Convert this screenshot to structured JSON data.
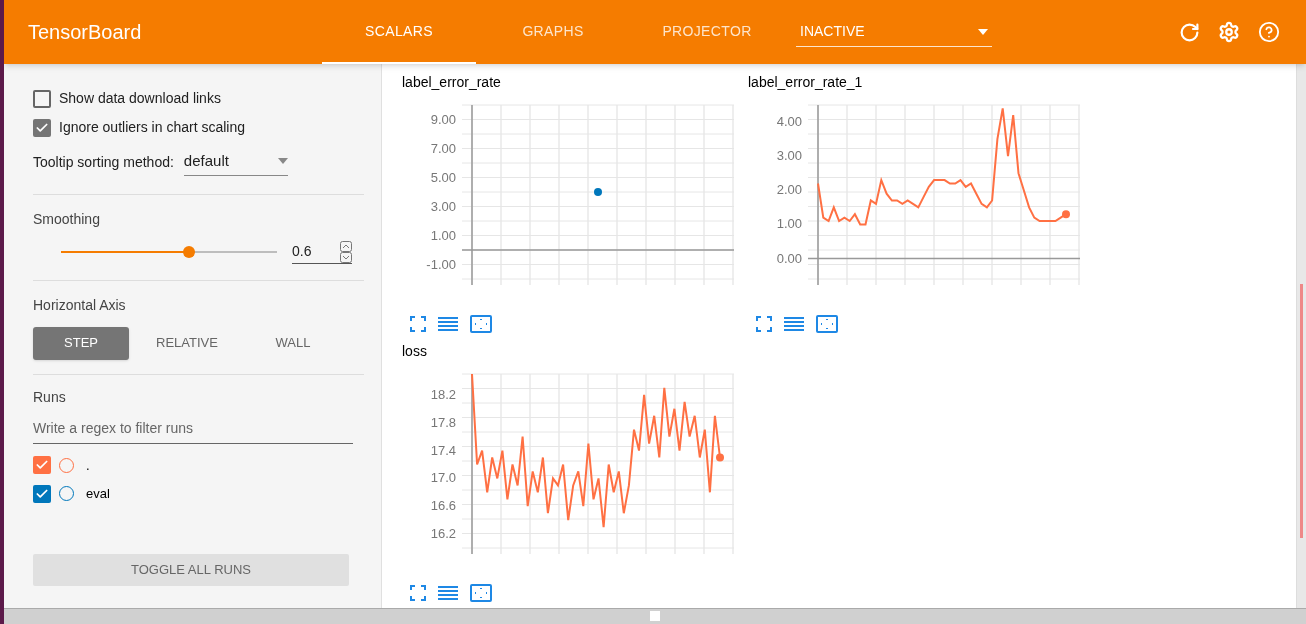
{
  "header": {
    "title": "TensorBoard",
    "tabs": [
      {
        "label": "SCALARS",
        "selected": true
      },
      {
        "label": "GRAPHS",
        "selected": false
      },
      {
        "label": "PROJECTOR",
        "selected": false
      }
    ],
    "dropdown": {
      "value": "INACTIVE"
    }
  },
  "sidebar": {
    "options": [
      {
        "label": "Show data download links",
        "checked": false
      },
      {
        "label": "Ignore outliers in chart scaling",
        "checked": true
      }
    ],
    "tooltip_sorting": {
      "label": "Tooltip sorting method:",
      "value": "default"
    },
    "smoothing": {
      "label": "Smoothing",
      "level": 0.6,
      "reading": "0.6"
    },
    "horizontal_axis": {
      "label": "Horizontal Axis",
      "options": [
        {
          "label": "STEP",
          "selected": true
        },
        {
          "label": "RELATIVE",
          "selected": false
        },
        {
          "label": "WALL",
          "selected": false
        }
      ]
    },
    "runs": {
      "label": "Runs",
      "placeholder": "Write a regex to filter runs",
      "items": [
        {
          "label": ".",
          "checked": true,
          "color": "#ff7043"
        },
        {
          "label": "eval",
          "checked": true,
          "color": "#0077bb"
        }
      ],
      "toggle_button": "TOGGLE ALL RUNS"
    }
  },
  "charts": [
    {
      "title": "label_error_rate",
      "chart_data": {
        "type": "line",
        "grid": true,
        "ylim": [
          -2,
          10
        ],
        "yticks": [
          {
            "value": 9,
            "label": "9.00"
          },
          {
            "value": 7,
            "label": "7.00"
          },
          {
            "value": 5,
            "label": "5.00"
          },
          {
            "value": 3,
            "label": "3.00"
          },
          {
            "value": 1,
            "label": "1.00"
          },
          {
            "value": -1,
            "label": "-1.00"
          }
        ],
        "series": [
          {
            "color": "#0077bb",
            "marker": true,
            "values": [
              4.0
            ]
          }
        ]
      }
    },
    {
      "title": "label_error_rate_1",
      "chart_data": {
        "type": "line",
        "grid": true,
        "ylim": [
          -0.6,
          4.5
        ],
        "yticks": [
          {
            "value": 4,
            "label": "4.00"
          },
          {
            "value": 3,
            "label": "3.00"
          },
          {
            "value": 2,
            "label": "2.00"
          },
          {
            "value": 1,
            "label": "1.00"
          },
          {
            "value": 0,
            "label": "0.00"
          }
        ],
        "series": [
          {
            "color": "#ff7043",
            "marker": true,
            "values": [
              2.2,
              1.2,
              1.1,
              1.5,
              1.1,
              1.2,
              1.1,
              1.3,
              1.0,
              1.0,
              1.7,
              1.6,
              2.3,
              1.9,
              1.7,
              1.7,
              1.6,
              1.7,
              1.6,
              1.5,
              1.8,
              2.1,
              2.3,
              2.3,
              2.3,
              2.2,
              2.2,
              2.3,
              2.1,
              2.2,
              1.9,
              1.6,
              1.5,
              1.7,
              3.5,
              4.4,
              3.0,
              4.2,
              2.5,
              2.0,
              1.5,
              1.2,
              1.1,
              1.1,
              1.1,
              1.1,
              1.2,
              1.3
            ]
          }
        ]
      }
    },
    {
      "title": "loss",
      "chart_data": {
        "type": "line",
        "grid": true,
        "ylim": [
          16.0,
          18.5
        ],
        "yticks": [
          {
            "value": 18.2,
            "label": "18.2"
          },
          {
            "value": 17.8,
            "label": "17.8"
          },
          {
            "value": 17.4,
            "label": "17.4"
          },
          {
            "value": 17.0,
            "label": "17.0"
          },
          {
            "value": 16.6,
            "label": "16.6"
          },
          {
            "value": 16.2,
            "label": "16.2"
          }
        ],
        "series": [
          {
            "color": "#ff7043",
            "marker": true,
            "values": [
              18.5,
              17.2,
              17.4,
              16.8,
              17.3,
              17.0,
              17.4,
              16.7,
              17.2,
              16.9,
              17.6,
              16.6,
              17.1,
              16.8,
              17.3,
              16.5,
              17.0,
              16.9,
              17.2,
              16.4,
              16.9,
              17.1,
              16.6,
              17.5,
              16.7,
              17.0,
              16.3,
              17.2,
              16.8,
              17.1,
              16.5,
              16.9,
              17.7,
              17.4,
              18.2,
              17.5,
              17.9,
              17.3,
              18.3,
              17.6,
              18.0,
              17.4,
              18.1,
              17.6,
              17.9,
              17.3,
              17.7,
              16.8,
              17.9,
              17.3
            ]
          }
        ]
      }
    }
  ]
}
